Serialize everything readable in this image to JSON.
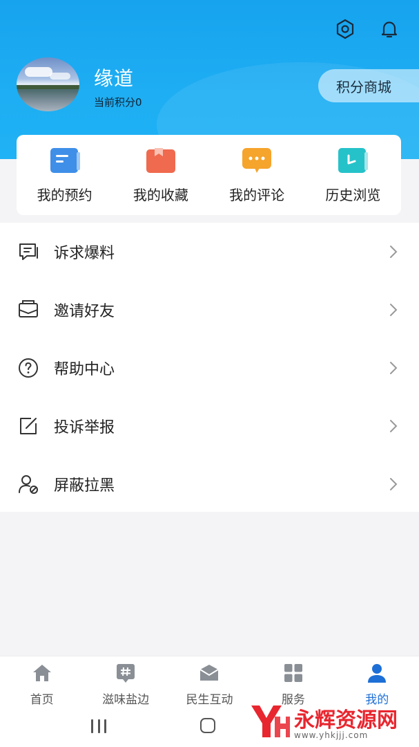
{
  "header": {
    "username": "缘道",
    "points_label": "当前积分0",
    "mall_button": "积分商城",
    "icons": [
      "settings-hexagon-icon",
      "bell-icon"
    ],
    "bg_color": "#1aa8f0"
  },
  "quick_actions": [
    {
      "label": "我的预约",
      "icon": "reservation-icon",
      "color": "#3f8fe8"
    },
    {
      "label": "我的收藏",
      "icon": "bookmark-icon",
      "color": "#ef6a4f"
    },
    {
      "label": "我的评论",
      "icon": "comment-icon",
      "color": "#f5a42c"
    },
    {
      "label": "历史浏览",
      "icon": "history-icon",
      "color": "#26c2c9"
    }
  ],
  "menu": [
    {
      "label": "诉求爆料",
      "icon": "report-chat-icon"
    },
    {
      "label": "邀请好友",
      "icon": "envelope-icon"
    },
    {
      "label": "帮助中心",
      "icon": "help-circle-icon"
    },
    {
      "label": "投诉举报",
      "icon": "edit-square-icon"
    },
    {
      "label": "屏蔽拉黑",
      "icon": "user-block-icon"
    }
  ],
  "tabbar": [
    {
      "label": "首页",
      "icon": "home-icon",
      "active": false
    },
    {
      "label": "滋味盐边",
      "icon": "hashtag-chat-icon",
      "active": false
    },
    {
      "label": "民生互动",
      "icon": "mail-box-icon",
      "active": false
    },
    {
      "label": "服务",
      "icon": "grid-icon",
      "active": false
    },
    {
      "label": "我的",
      "icon": "person-icon",
      "active": true
    }
  ],
  "watermark": {
    "text": "永辉资源网",
    "url": "www.yhkjjj.com",
    "color": "#e8262f"
  },
  "accent_color": "#1d6fd6"
}
